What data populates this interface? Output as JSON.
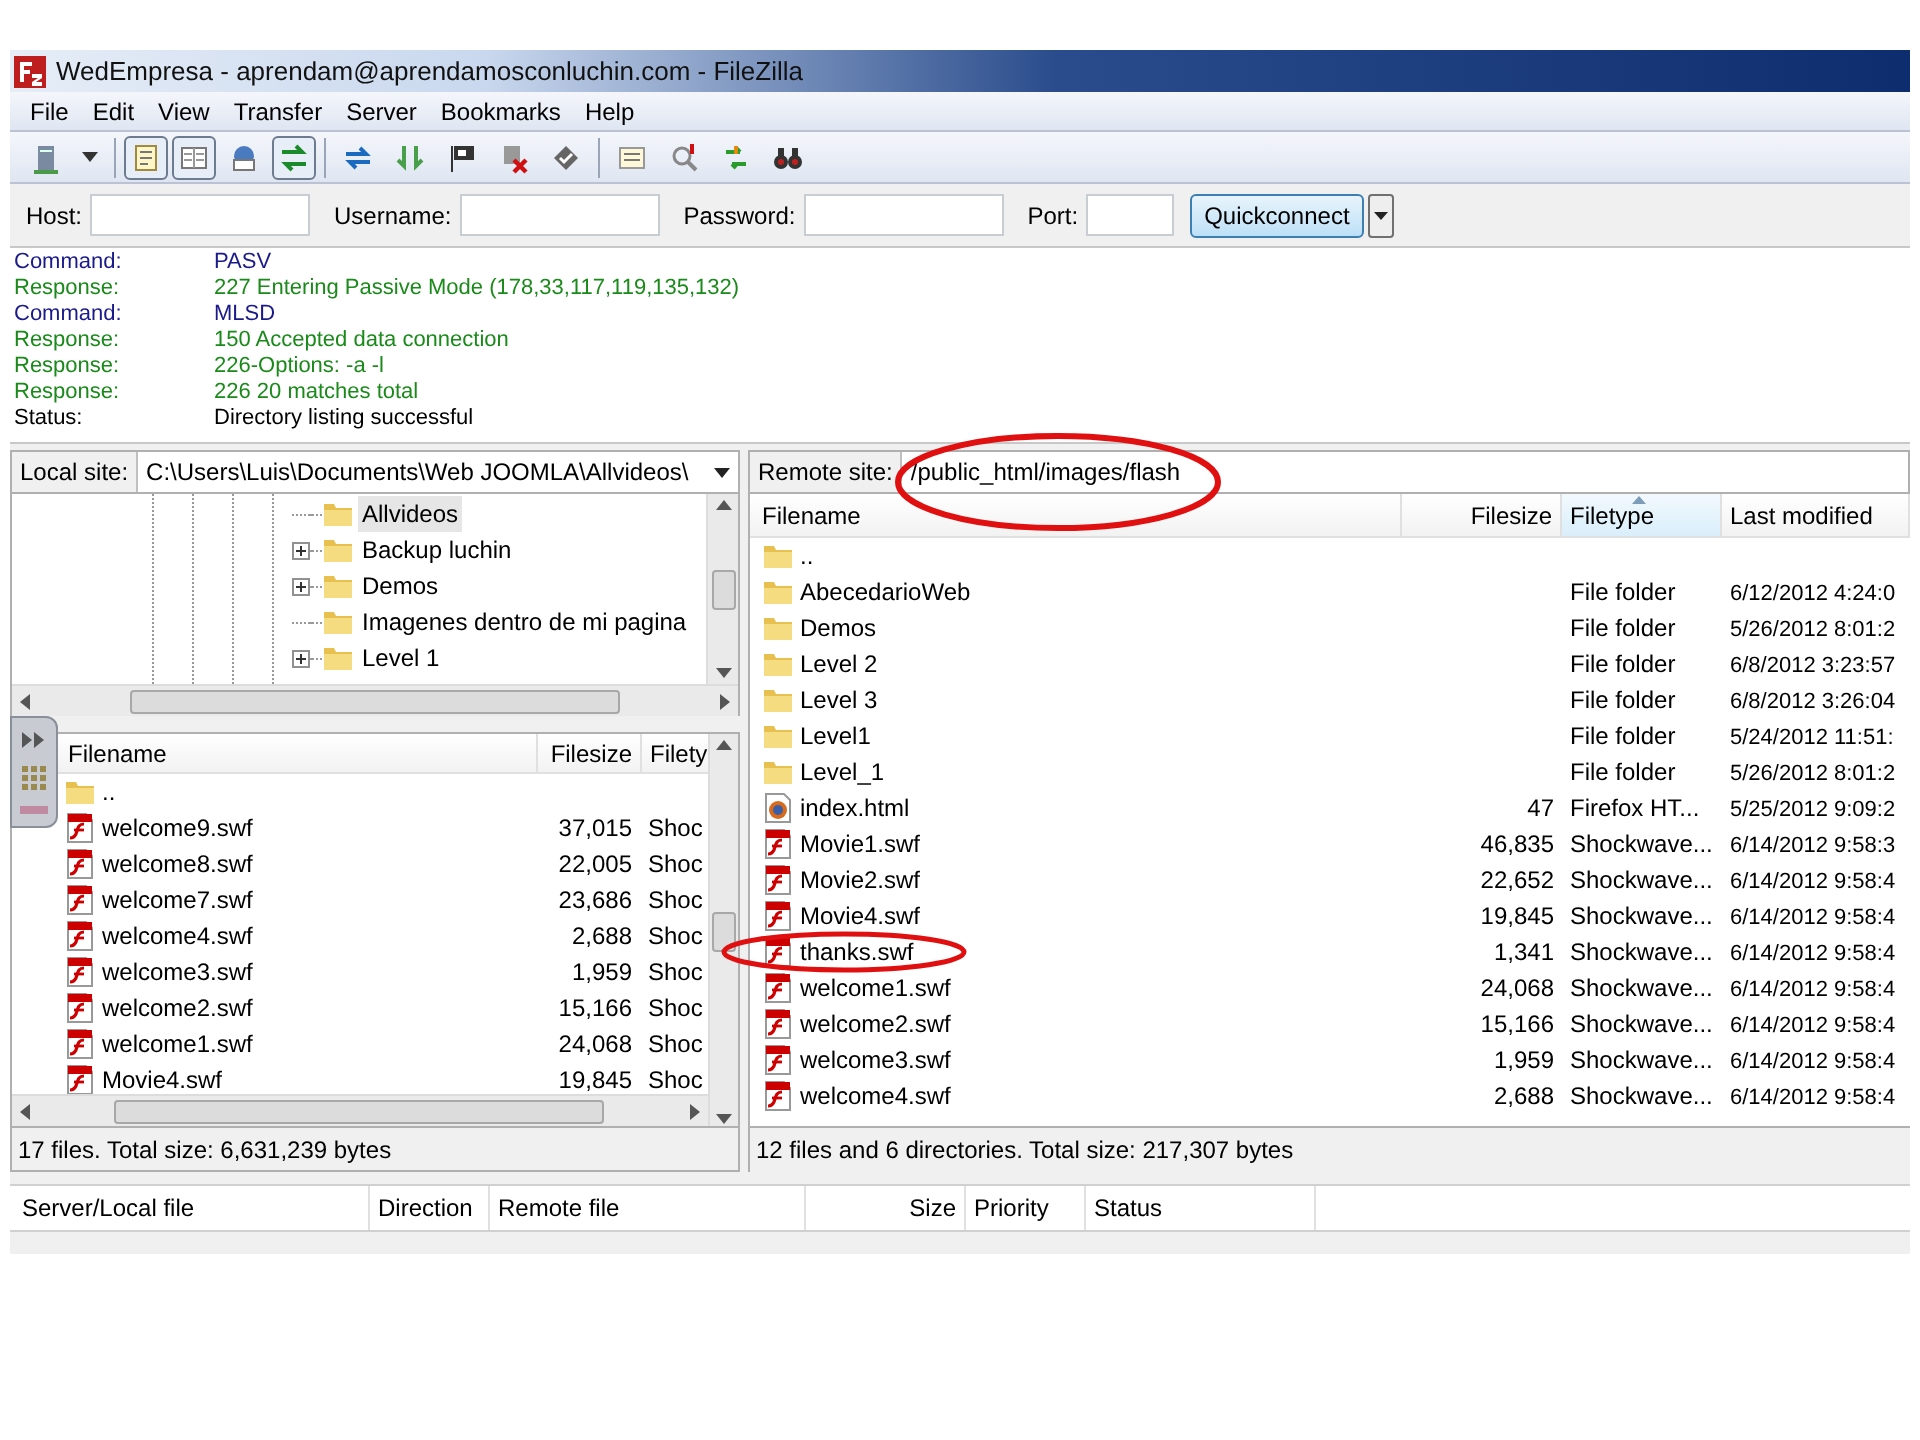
{
  "window": {
    "title": "WedEmpresa - aprendam@aprendamosconluchin.com - FileZilla"
  },
  "menu": [
    "File",
    "Edit",
    "View",
    "Transfer",
    "Server",
    "Bookmarks",
    "Help"
  ],
  "toolbar": [
    {
      "kind": "server",
      "pressed": false
    },
    {
      "kind": "caret",
      "pressed": false
    },
    {
      "kind": "notepad",
      "pressed": true
    },
    {
      "kind": "panes",
      "pressed": true
    },
    {
      "kind": "globe",
      "pressed": false
    },
    {
      "kind": "transfer",
      "pressed": true
    },
    {
      "kind": "refresh",
      "pressed": false
    },
    {
      "kind": "down",
      "pressed": false
    },
    {
      "kind": "flag",
      "pressed": false
    },
    {
      "kind": "cross",
      "pressed": false
    },
    {
      "kind": "check",
      "pressed": false
    },
    {
      "kind": "list",
      "pressed": false
    },
    {
      "kind": "magnifier",
      "pressed": false
    },
    {
      "kind": "sync",
      "pressed": false
    },
    {
      "kind": "binoculars",
      "pressed": false
    }
  ],
  "quickconnect": {
    "host_label": "Host:",
    "username_label": "Username:",
    "password_label": "Password:",
    "port_label": "Port:",
    "button": "Quickconnect"
  },
  "log": [
    {
      "kind": "command",
      "label": "Command:",
      "text": "PASV"
    },
    {
      "kind": "response",
      "label": "Response:",
      "text": "227 Entering Passive Mode (178,33,117,119,135,132)"
    },
    {
      "kind": "command",
      "label": "Command:",
      "text": "MLSD"
    },
    {
      "kind": "response",
      "label": "Response:",
      "text": "150 Accepted data connection"
    },
    {
      "kind": "response",
      "label": "Response:",
      "text": "226-Options: -a -l"
    },
    {
      "kind": "response",
      "label": "Response:",
      "text": "226 20 matches total"
    },
    {
      "kind": "status",
      "label": "Status:",
      "text": "Directory listing successful"
    }
  ],
  "local": {
    "site_label": "Local site:",
    "path": "C:\\Users\\Luis\\Documents\\Web JOOMLA\\Allvideos\\",
    "tree": [
      {
        "name": "Allvideos",
        "expandable": false,
        "selected": true
      },
      {
        "name": "Backup luchin",
        "expandable": true,
        "selected": false
      },
      {
        "name": "Demos",
        "expandable": true,
        "selected": false
      },
      {
        "name": "Imagenes dentro de mi pagina",
        "expandable": false,
        "selected": false
      },
      {
        "name": "Level 1",
        "expandable": true,
        "selected": false
      }
    ],
    "columns": [
      "Filename",
      "Filesize",
      "Filety"
    ],
    "rows": [
      {
        "kind": "folder",
        "name": "..",
        "size": "",
        "type": ""
      },
      {
        "kind": "swf",
        "name": "welcome9.swf",
        "size": "37,015",
        "type": "Shoc"
      },
      {
        "kind": "swf",
        "name": "welcome8.swf",
        "size": "22,005",
        "type": "Shoc"
      },
      {
        "kind": "swf",
        "name": "welcome7.swf",
        "size": "23,686",
        "type": "Shoc"
      },
      {
        "kind": "swf",
        "name": "welcome4.swf",
        "size": "2,688",
        "type": "Shoc"
      },
      {
        "kind": "swf",
        "name": "welcome3.swf",
        "size": "1,959",
        "type": "Shoc"
      },
      {
        "kind": "swf",
        "name": "welcome2.swf",
        "size": "15,166",
        "type": "Shoc"
      },
      {
        "kind": "swf",
        "name": "welcome1.swf",
        "size": "24,068",
        "type": "Shoc"
      },
      {
        "kind": "swf",
        "name": "Movie4.swf",
        "size": "19,845",
        "type": "Shoc"
      }
    ],
    "status": "17 files. Total size: 6,631,239 bytes"
  },
  "remote": {
    "site_label": "Remote site:",
    "path": "/public_html/images/flash",
    "columns": [
      {
        "label": "Filename",
        "sorted": false
      },
      {
        "label": "Filesize",
        "sorted": false
      },
      {
        "label": "Filetype",
        "sorted": true
      },
      {
        "label": "Last modified",
        "sorted": false
      }
    ],
    "rows": [
      {
        "kind": "folder",
        "name": "..",
        "size": "",
        "type": "",
        "modified": ""
      },
      {
        "kind": "folder",
        "name": "AbecedarioWeb",
        "size": "",
        "type": "File folder",
        "modified": "6/12/2012 4:24:0"
      },
      {
        "kind": "folder",
        "name": "Demos",
        "size": "",
        "type": "File folder",
        "modified": "5/26/2012 8:01:2"
      },
      {
        "kind": "folder",
        "name": "Level 2",
        "size": "",
        "type": "File folder",
        "modified": "6/8/2012 3:23:57"
      },
      {
        "kind": "folder",
        "name": "Level 3",
        "size": "",
        "type": "File folder",
        "modified": "6/8/2012 3:26:04"
      },
      {
        "kind": "folder",
        "name": "Level1",
        "size": "",
        "type": "File folder",
        "modified": "5/24/2012 11:51:"
      },
      {
        "kind": "folder",
        "name": "Level_1",
        "size": "",
        "type": "File folder",
        "modified": "5/26/2012 8:01:2"
      },
      {
        "kind": "html",
        "name": "index.html",
        "size": "47",
        "type": "Firefox HT...",
        "modified": "5/25/2012 9:09:2"
      },
      {
        "kind": "swf",
        "name": "Movie1.swf",
        "size": "46,835",
        "type": "Shockwave...",
        "modified": "6/14/2012 9:58:3"
      },
      {
        "kind": "swf",
        "name": "Movie2.swf",
        "size": "22,652",
        "type": "Shockwave...",
        "modified": "6/14/2012 9:58:4"
      },
      {
        "kind": "swf",
        "name": "Movie4.swf",
        "size": "19,845",
        "type": "Shockwave...",
        "modified": "6/14/2012 9:58:4"
      },
      {
        "kind": "swf",
        "name": "thanks.swf",
        "size": "1,341",
        "type": "Shockwave...",
        "modified": "6/14/2012 9:58:4"
      },
      {
        "kind": "swf",
        "name": "welcome1.swf",
        "size": "24,068",
        "type": "Shockwave...",
        "modified": "6/14/2012 9:58:4"
      },
      {
        "kind": "swf",
        "name": "welcome2.swf",
        "size": "15,166",
        "type": "Shockwave...",
        "modified": "6/14/2012 9:58:4"
      },
      {
        "kind": "swf",
        "name": "welcome3.swf",
        "size": "1,959",
        "type": "Shockwave...",
        "modified": "6/14/2012 9:58:4"
      },
      {
        "kind": "swf",
        "name": "welcome4.swf",
        "size": "2,688",
        "type": "Shockwave...",
        "modified": "6/14/2012 9:58:4"
      }
    ],
    "status": "12 files and 6 directories. Total size: 217,307 bytes"
  },
  "queue": {
    "columns": [
      "Server/Local file",
      "Direction",
      "Remote file",
      "Size",
      "Priority",
      "Status"
    ]
  }
}
